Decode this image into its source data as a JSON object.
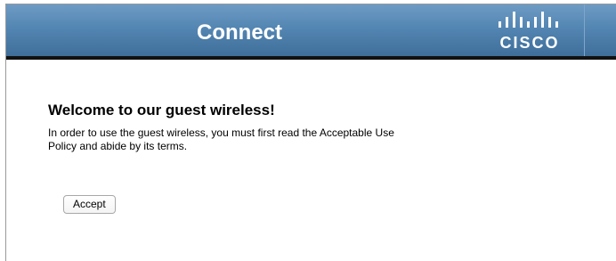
{
  "header": {
    "title": "Connect",
    "logo_text": "CISCO",
    "background_color": "#5486b3",
    "bottom_border_color": "#111111"
  },
  "main": {
    "heading": "Welcome to our guest wireless!",
    "body_line_1": "In order to use the guest wireless, you must first read the Acceptable Use",
    "body_line_2": "Policy and abide by its terms.",
    "accept_label": "Accept"
  },
  "icons": {
    "logo": "cisco-logo-icon"
  }
}
